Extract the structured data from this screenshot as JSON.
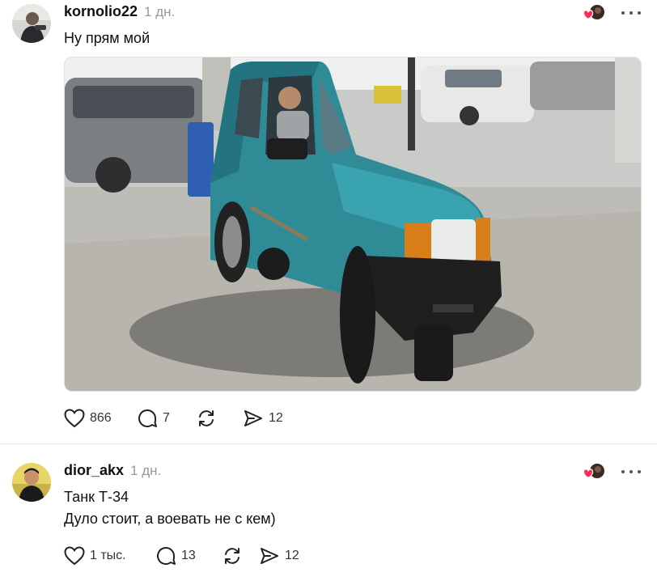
{
  "posts": [
    {
      "username": "kornolio22",
      "time": "1 дн.",
      "text": "Ну прям мой",
      "actions": {
        "likes": "866",
        "replies": "7",
        "shares": "12"
      }
    },
    {
      "username": "dior_akx",
      "time": "1 дн.",
      "text_line1": "Танк Т-34",
      "text_line2": "Дуло стоит, а воевать не с кем)",
      "actions": {
        "likes": "1 тыс.",
        "replies": "13",
        "shares": "12"
      }
    }
  ],
  "colors": {
    "heart_liked": "#ff2d55",
    "muted": "#999999",
    "divider": "#e6e6e6"
  },
  "icons": [
    "heart-icon",
    "comment-icon",
    "repost-icon",
    "send-icon",
    "more-icon",
    "liked-by-avatar-icon"
  ]
}
